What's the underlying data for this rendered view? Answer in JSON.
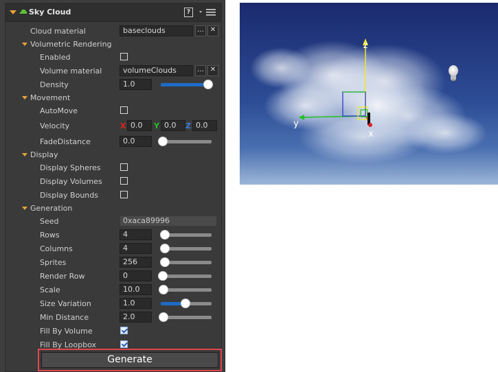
{
  "panel": {
    "title": "Sky Cloud",
    "help_label": "?",
    "cloud_material": {
      "label": "Cloud material",
      "value": "baseclouds"
    },
    "volumetric": {
      "header": "Volumetric Rendering",
      "enabled": {
        "label": "Enabled",
        "checked": false
      },
      "volume_material": {
        "label": "Volume material",
        "value": "volumeClouds"
      },
      "density": {
        "label": "Density",
        "value": "1.0",
        "level": 1.0
      }
    },
    "movement": {
      "header": "Movement",
      "automove": {
        "label": "AutoMove",
        "checked": false
      },
      "velocity": {
        "label": "Velocity",
        "x_label": "X",
        "x": "0.0",
        "y_label": "Y",
        "y": "0.0",
        "z_label": "Z",
        "z": "0.0"
      },
      "fade_distance": {
        "label": "FadeDistance",
        "value": "0.0",
        "level": 0.0
      }
    },
    "display": {
      "header": "Display",
      "spheres": {
        "label": "Display Spheres",
        "checked": false
      },
      "volumes": {
        "label": "Display Volumes",
        "checked": false
      },
      "bounds": {
        "label": "Display Bounds",
        "checked": false
      }
    },
    "generation": {
      "header": "Generation",
      "seed": {
        "label": "Seed",
        "value": "0xaca89996"
      },
      "rows": {
        "label": "Rows",
        "value": "4",
        "level": 0.04
      },
      "columns": {
        "label": "Columns",
        "value": "4",
        "level": 0.04
      },
      "sprites": {
        "label": "Sprites",
        "value": "256",
        "level": 0.05
      },
      "render_row": {
        "label": "Render Row",
        "value": "0",
        "level": 0.0
      },
      "scale": {
        "label": "Scale",
        "value": "10.0",
        "level": 0.01
      },
      "size_variation": {
        "label": "Size Variation",
        "value": "1.0",
        "level": 0.5
      },
      "min_distance": {
        "label": "Min Distance",
        "value": "2.0",
        "level": 0.02
      },
      "fill_by_volume": {
        "label": "Fill By Volume",
        "checked": true
      },
      "fill_by_loopbox": {
        "label": "Fill By Loopbox",
        "checked": true
      }
    },
    "generate_button": "Generate"
  },
  "viewport": {
    "gizmo_x_label": "x",
    "gizmo_y_label": "y",
    "gizmo_z_label": "z",
    "colors": {
      "x_axis": "#e02020",
      "y_axis": "#22c222",
      "z_axis": "#f4e81c",
      "selection_border": "#e0474c",
      "slider_fill": "#1e6bc6"
    }
  }
}
